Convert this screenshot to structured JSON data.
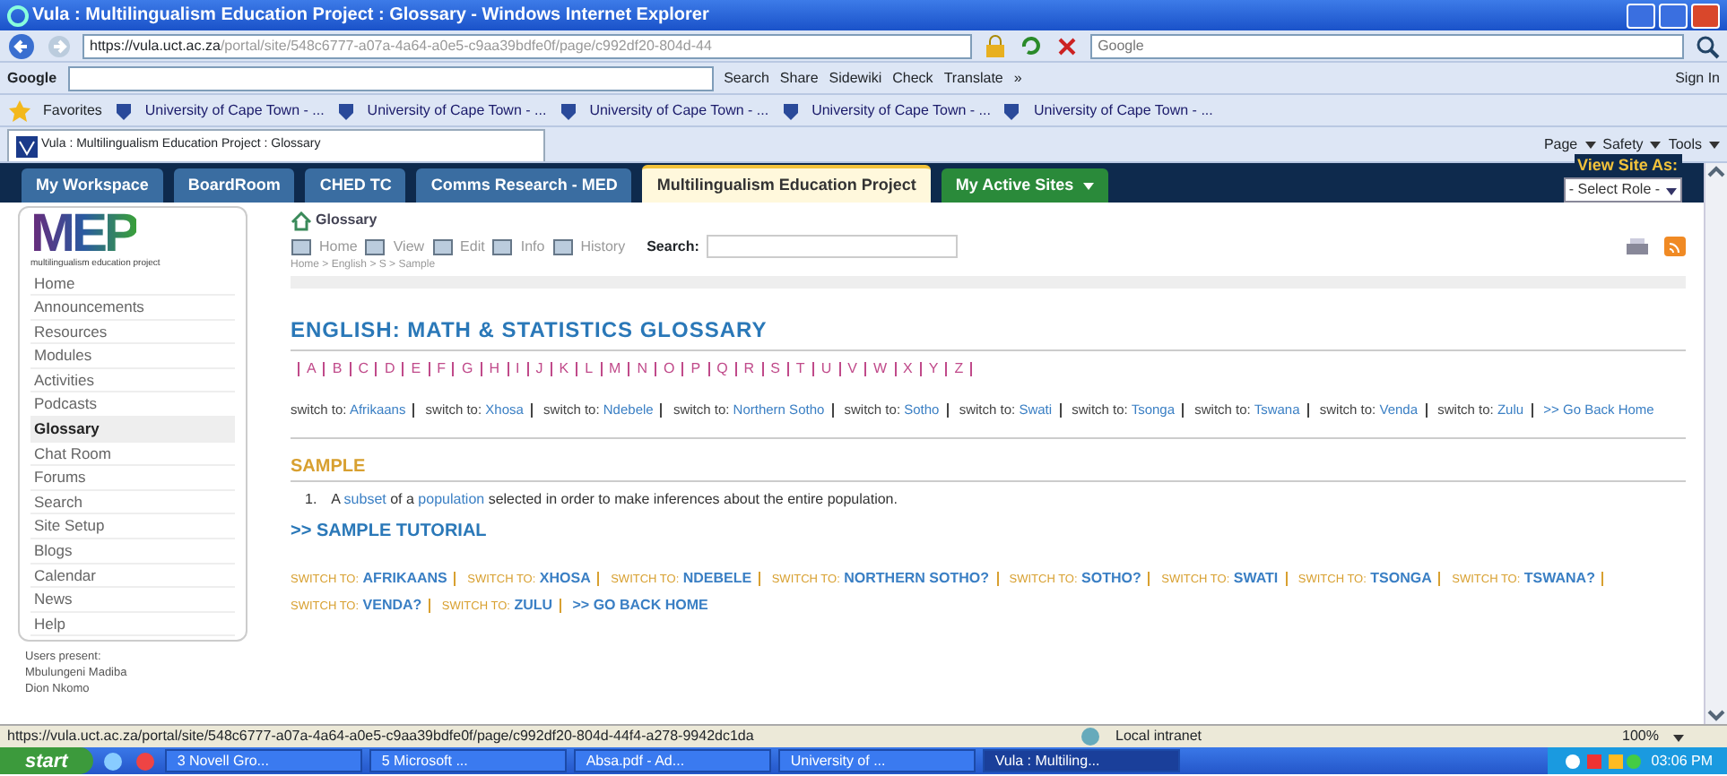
{
  "window": {
    "title": "Vula : Multilingualism Education Project : Glossary - Windows Internet Explorer"
  },
  "address_bar": {
    "url": "https://vula.uct.ac.za/portal/site/548c6777-a07a-4a64-a0e5-c9aa39bdfe0f/page/c992df20-804d-44",
    "search_placeholder": "Google"
  },
  "google_toolbar": {
    "brand": "Google",
    "items": [
      "Search",
      "Share",
      "Sidewiki",
      "Check",
      "Translate",
      "»"
    ],
    "sign_in": "Sign In"
  },
  "favorites_bar": {
    "label": "Favorites",
    "links": [
      "University of Cape Town - ...",
      "University of Cape Town - ...",
      "University of Cape Town - ...",
      "University of Cape Town - ...",
      "University of Cape Town - ..."
    ]
  },
  "browser_tab": {
    "title": "Vula : Multilingualism Education Project : Glossary"
  },
  "command_bar": [
    "Page",
    "Safety",
    "Tools"
  ],
  "site_tabs": [
    {
      "label": "My Workspace",
      "selected": false
    },
    {
      "label": "BoardRoom",
      "selected": false
    },
    {
      "label": "CHED TC",
      "selected": false
    },
    {
      "label": "Comms Research - MED",
      "selected": false
    },
    {
      "label": "Multilingualism Education Project",
      "selected": true
    }
  ],
  "active_sites": "My Active Sites",
  "view_site_as": {
    "label": "View Site As:",
    "select": "- Select Role -"
  },
  "logo": {
    "text": "MEP",
    "subtitle": "multilingualism education project"
  },
  "sidebar": {
    "items": [
      {
        "label": "Home",
        "selected": false
      },
      {
        "label": "Announcements",
        "selected": false
      },
      {
        "label": "Resources",
        "selected": false
      },
      {
        "label": "Modules",
        "selected": false
      },
      {
        "label": "Activities",
        "selected": false
      },
      {
        "label": "Podcasts",
        "selected": false
      },
      {
        "label": "Glossary",
        "selected": true
      },
      {
        "label": "Chat Room",
        "selected": false
      },
      {
        "label": "Forums",
        "selected": false
      },
      {
        "label": "Search",
        "selected": false
      },
      {
        "label": "Site Setup",
        "selected": false
      },
      {
        "label": "Blogs",
        "selected": false
      },
      {
        "label": "Calendar",
        "selected": false
      },
      {
        "label": "News",
        "selected": false
      },
      {
        "label": "Help",
        "selected": false
      }
    ]
  },
  "users_present": {
    "title": "Users present:",
    "names": [
      "Mbulungeni Madiba",
      "Dion Nkomo"
    ]
  },
  "tool": {
    "title": "Glossary",
    "actions": [
      "Home",
      "View",
      "Edit",
      "Info",
      "History"
    ],
    "search_label": "Search:"
  },
  "breadcrumb": "Home > English > S > Sample",
  "heading": "ENGLISH: MATH & STATISTICS GLOSSARY",
  "alphabet": [
    "A",
    "B",
    "C",
    "D",
    "E",
    "F",
    "G",
    "H",
    "I",
    "J",
    "K",
    "L",
    "M",
    "N",
    "O",
    "P",
    "Q",
    "R",
    "S",
    "T",
    "U",
    "V",
    "W",
    "X",
    "Y",
    "Z"
  ],
  "switch_links": [
    {
      "prefix": "switch to:",
      "language": "Afrikaans"
    },
    {
      "prefix": "switch to:",
      "language": "Xhosa"
    },
    {
      "prefix": "switch to:",
      "language": "Ndebele"
    },
    {
      "prefix": "switch to:",
      "language": "Northern Sotho"
    },
    {
      "prefix": "switch to:",
      "language": "Sotho"
    },
    {
      "prefix": "switch to:",
      "language": "Swati"
    },
    {
      "prefix": "switch to:",
      "language": "Tsonga"
    },
    {
      "prefix": "switch to:",
      "language": "Tswana"
    },
    {
      "prefix": "switch to:",
      "language": "Venda"
    },
    {
      "prefix": "switch to:",
      "language": "Zulu"
    }
  ],
  "go_back": ">> Go Back Home",
  "term": {
    "title": "SAMPLE",
    "number": "1.",
    "definition": [
      {
        "text": "A ",
        "link": false
      },
      {
        "text": "subset",
        "link": true
      },
      {
        "text": " of a ",
        "link": false
      },
      {
        "text": "population",
        "link": true
      },
      {
        "text": " selected in order to make inferences about the entire population.",
        "link": false
      }
    ]
  },
  "tutorial": ">> SAMPLE TUTORIAL",
  "tutorial_switch_links": [
    {
      "prefix": "SWITCH TO:",
      "language": "AFRIKAANS"
    },
    {
      "prefix": "SWITCH TO:",
      "language": "XHOSA"
    },
    {
      "prefix": "SWITCH TO:",
      "language": "NDEBELE"
    },
    {
      "prefix": "SWITCH TO:",
      "language": "NORTHERN SOTHO?"
    },
    {
      "prefix": "SWITCH TO:",
      "language": "SOTHO?"
    },
    {
      "prefix": "SWITCH TO:",
      "language": "SWATI"
    },
    {
      "prefix": "SWITCH TO:",
      "language": "TSONGA"
    },
    {
      "prefix": "SWITCH TO:",
      "language": "TSWANA?"
    },
    {
      "prefix": "SWITCH TO:",
      "language": "VENDA?"
    },
    {
      "prefix": "SWITCH TO:",
      "language": "ZULU"
    }
  ],
  "tutorial_go_back": ">> GO BACK HOME",
  "status_bar": {
    "url": "https://vula.uct.ac.za/portal/site/548c6777-a07a-4a64-a0e5-c9aa39bdfe0f/page/c992df20-804d-44f4-a278-9942dc1da",
    "zone": "Local intranet",
    "zoom": "100%"
  },
  "taskbar": {
    "start": "start",
    "tasks": [
      {
        "label": "3 Novell Gro...",
        "selected": false
      },
      {
        "label": "5 Microsoft ...",
        "selected": false
      },
      {
        "label": "Absa.pdf - Ad...",
        "selected": false
      },
      {
        "label": "University of ...",
        "selected": false
      },
      {
        "label": "Vula : Multiling...",
        "selected": true
      }
    ],
    "clock": "03:06 PM"
  }
}
